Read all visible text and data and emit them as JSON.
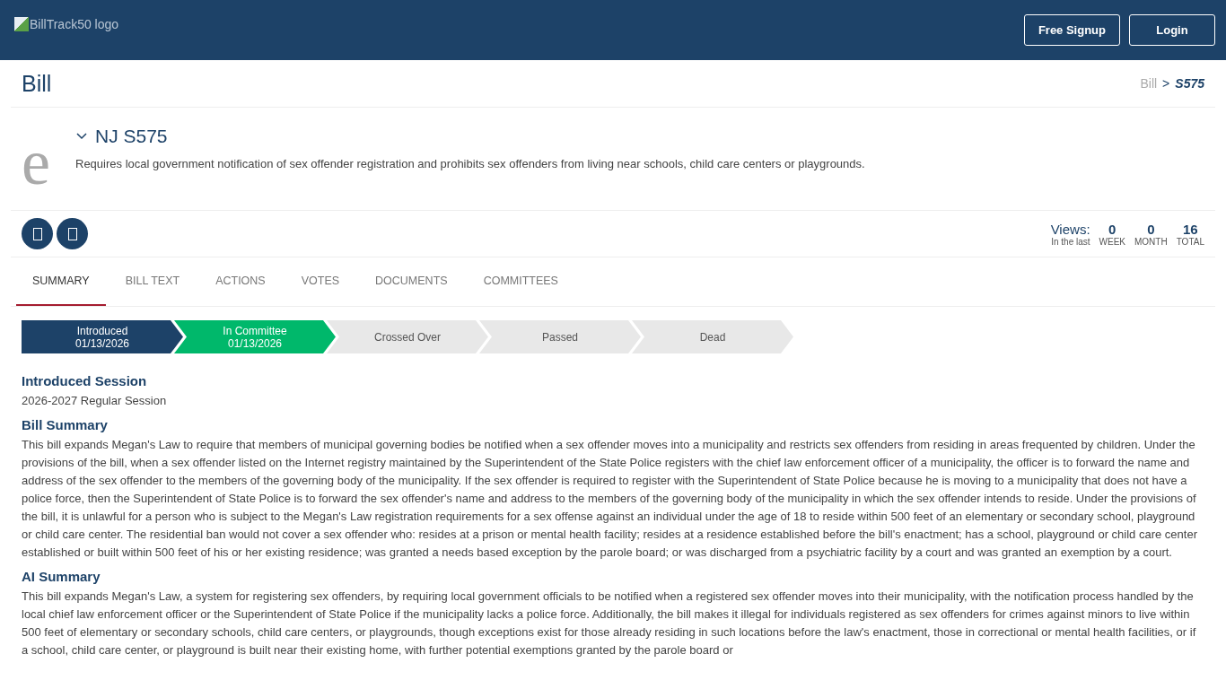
{
  "header": {
    "logo_alt": "BillTrack50 logo",
    "buttons": [
      {
        "label": "Free Signup"
      },
      {
        "label": "Login"
      }
    ]
  },
  "page": {
    "title": "Bill",
    "breadcrumb_separator": ">",
    "breadcrumb": [
      {
        "label": "Bill",
        "current": false
      },
      {
        "label": "S575",
        "current": true
      }
    ]
  },
  "bill": {
    "avatar_letter": "e",
    "expanded": true,
    "number": "NJ S575",
    "description": "Requires local government notification of sex offender registration and prohibits sex offenders from living near schools, child care centers or playgrounds."
  },
  "views": {
    "label": "Views:",
    "sublabel": "In the last",
    "stats": [
      {
        "value": "0",
        "period": "WEEK"
      },
      {
        "value": "0",
        "period": "MONTH"
      },
      {
        "value": "16",
        "period": "TOTAL"
      }
    ]
  },
  "tabs": [
    {
      "label": "SUMMARY",
      "selected": true
    },
    {
      "label": "BILL TEXT",
      "selected": false
    },
    {
      "label": "ACTIONS",
      "selected": false
    },
    {
      "label": "VOTES",
      "selected": false
    },
    {
      "label": "DOCUMENTS",
      "selected": false
    },
    {
      "label": "COMMITTEES",
      "selected": false
    }
  ],
  "progress": [
    {
      "label": "Introduced",
      "date": "01/13/2026",
      "kind": "done"
    },
    {
      "label": "In Committee",
      "date": "01/13/2026",
      "kind": "current"
    },
    {
      "label": "Crossed Over",
      "kind": "pending"
    },
    {
      "label": "Passed",
      "kind": "pending"
    },
    {
      "label": "Dead",
      "kind": "pending"
    }
  ],
  "sections": [
    {
      "heading": "Introduced Session",
      "text": "2026-2027 Regular Session"
    },
    {
      "heading": "Bill Summary",
      "text": "This bill expands Megan's Law to require that members of municipal governing bodies be notified when a sex offender moves into a municipality and restricts sex offenders from residing in areas frequented by children. Under the provisions of the bill, when a sex offender listed on the Internet registry maintained by the Superintendent of the State Police registers with the chief law enforcement officer of a municipality, the officer is to forward the name and address of the sex offender to the members of the governing body of the municipality. If the sex offender is required to register with the Superintendent of State Police because he is moving to a municipality that does not have a police force, then the Superintendent of State Police is to forward the sex offender's name and address to the members of the governing body of the municipality in which the sex offender intends to reside. Under the provisions of the bill, it is unlawful for a person who is subject to the Megan's Law registration requirements for a sex offense against an individual under the age of 18 to reside within 500 feet of an elementary or secondary school, playground or child care center. The residential ban would not cover a sex offender who: resides at a prison or mental health facility; resides at a residence established before the bill's enactment; has a school, playground or child care center established or built within 500 feet of his or her existing residence; was granted a needs based exception by the parole board; or was discharged from a psychiatric facility by a court and was granted an exemption by a court."
    },
    {
      "heading": "AI Summary",
      "text": "This bill expands Megan's Law, a system for registering sex offenders, by requiring local government officials to be notified when a registered sex offender moves into their municipality, with the notification process handled by the local chief law enforcement officer or the Superintendent of State Police if the municipality lacks a police force. Additionally, the bill makes it illegal for individuals registered as sex offenders for crimes against minors to live within 500 feet of elementary or secondary schools, child care centers, or playgrounds, though exceptions exist for those already residing in such locations before the law's enactment, those in correctional or mental health facilities, or if a school, child care center, or playground is built near their existing home, with further potential exemptions granted by the parole board or"
    }
  ]
}
